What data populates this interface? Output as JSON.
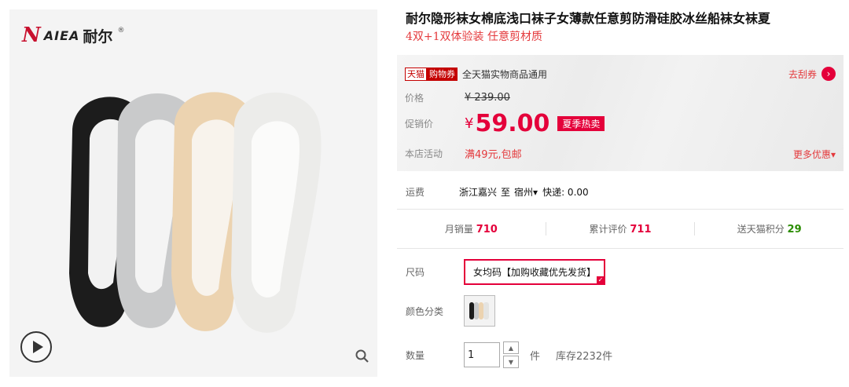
{
  "gallery": {
    "brand_mark": "N",
    "brand_word": "AIEA",
    "brand_cn": "耐尔",
    "brand_reg": "®"
  },
  "product": {
    "title": "耐尔隐形袜女棉底浅口袜子女薄款任意剪防滑硅胶冰丝船袜女袜夏",
    "subtitle": "4双+1双体验装 任意剪材质"
  },
  "promo": {
    "tag_tmall": "天猫",
    "tag_coupon": "购物券",
    "coupon_text": "全天猫实物商品通用",
    "coupon_action": "去刮券",
    "coupon_arrow": "›",
    "price_label": "价格",
    "price_original": "¥ 239.00",
    "sale_label": "促销价",
    "currency": "¥",
    "sale_price": "59.00",
    "season_tag": "夏季热卖",
    "activity_label": "本店活动",
    "activity_text": "满49元,包邮",
    "more": "更多优惠",
    "more_arrow": "▾"
  },
  "shipping": {
    "label": "运费",
    "origin": "浙江嘉兴",
    "to": "至",
    "destination": "宿州",
    "dest_arrow": "▾",
    "express": "快递: 0.00"
  },
  "stats": {
    "sales_label": "月销量",
    "sales": "710",
    "reviews_label": "累计评价",
    "reviews": "711",
    "points_label": "送天猫积分",
    "points": "29"
  },
  "options": {
    "size_label": "尺码",
    "size_value": "女均码【加购收藏优先发货】",
    "color_label": "颜色分类",
    "qty_label": "数量",
    "qty_value": "1",
    "qty_unit": "件",
    "stock": "库存2232件"
  },
  "icons": {
    "play": "play-icon",
    "zoom": "search-icon",
    "up": "▲",
    "down": "▼"
  },
  "colors": {
    "accent": "#e4003a",
    "tmall_red": "#c40000",
    "green": "#2a8c00"
  }
}
